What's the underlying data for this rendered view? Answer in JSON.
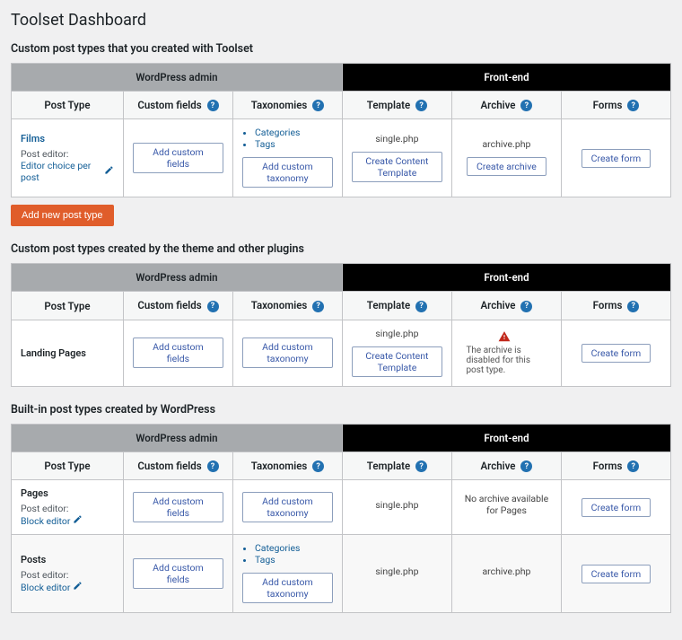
{
  "page_title": "Toolset Dashboard",
  "help": "?",
  "sections": [
    {
      "key": "toolset",
      "title": "Custom post types that you created with Toolset",
      "rows": [
        {
          "key": "films",
          "name": "Films",
          "name_link": true,
          "editor_label": "Post editor:",
          "editor_value": "Editor choice per post",
          "custom_fields_btn": "Add custom fields",
          "tax_list": [
            "Categories",
            "Tags"
          ],
          "tax_btn": "Add custom taxonomy",
          "template_text": "single.php",
          "template_btn": "Create Content Template",
          "archive_text": "archive.php",
          "archive_btn": "Create archive",
          "forms_btn": "Create form"
        }
      ],
      "add_btn": "Add new post type"
    },
    {
      "key": "theme",
      "title": "Custom post types created by the theme and other plugins",
      "rows": [
        {
          "key": "landing",
          "name": "Landing Pages",
          "name_link": false,
          "custom_fields_btn": "Add custom fields",
          "tax_btn": "Add custom taxonomy",
          "template_text": "single.php",
          "template_btn": "Create Content Template",
          "archive_warning": "The archive is disabled for this post type.",
          "forms_btn": "Create form"
        }
      ]
    },
    {
      "key": "builtin",
      "title": "Built-in post types created by WordPress",
      "rows": [
        {
          "key": "pages",
          "name": "Pages",
          "name_link": false,
          "editor_label": "Post editor:",
          "editor_value": "Block editor",
          "custom_fields_btn": "Add custom fields",
          "tax_btn": "Add custom taxonomy",
          "template_text": "single.php",
          "archive_text_plain": "No archive available for Pages",
          "forms_btn": "Create form"
        },
        {
          "key": "posts",
          "name": "Posts",
          "name_link": false,
          "editor_label": "Post editor:",
          "editor_value": "Block editor",
          "custom_fields_btn": "Add custom fields",
          "tax_list": [
            "Categories",
            "Tags"
          ],
          "tax_btn": "Add custom taxonomy",
          "template_text": "single.php",
          "archive_text": "archive.php",
          "forms_btn": "Create form",
          "alt": true
        }
      ]
    }
  ],
  "headers": {
    "wp_admin": "WordPress admin",
    "front_end": "Front-end",
    "post_type": "Post Type",
    "custom_fields": "Custom fields",
    "taxonomies": "Taxonomies",
    "template": "Template",
    "archive": "Archive",
    "forms": "Forms"
  }
}
